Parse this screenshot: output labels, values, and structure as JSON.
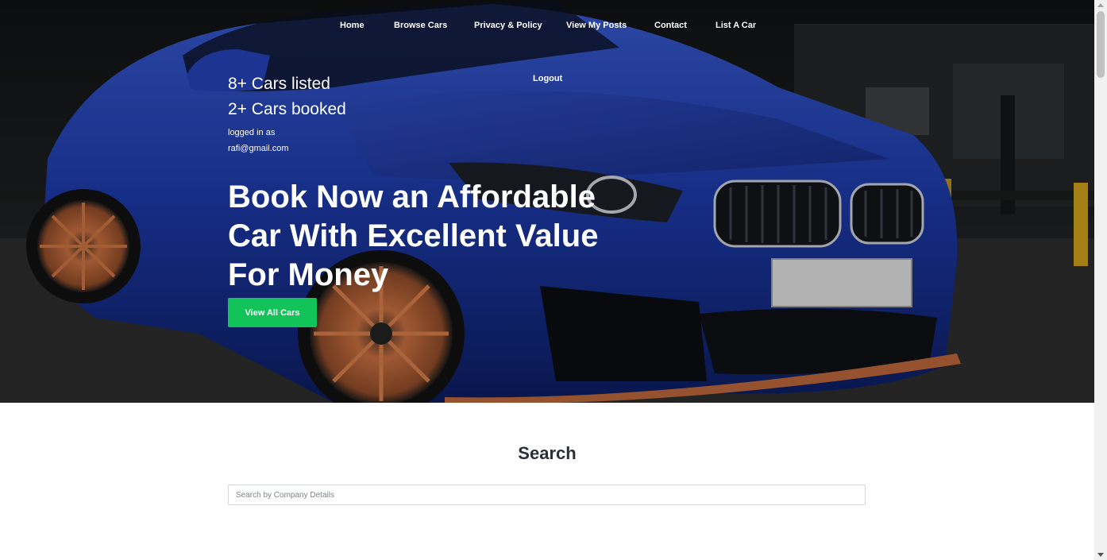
{
  "nav": {
    "items": [
      {
        "label": "Home"
      },
      {
        "label": "Browse Cars"
      },
      {
        "label": "Privacy & Policy"
      },
      {
        "label": "View My Posts"
      },
      {
        "label": "Contact"
      },
      {
        "label": "List A Car"
      },
      {
        "label": "Logout"
      }
    ]
  },
  "hero": {
    "cars_listed": "8+ Cars listed",
    "cars_booked": "2+ Cars booked",
    "logged_in_label": "logged in as",
    "user_email": "rafi@gmail.com",
    "headline": "Book Now an Affordable Car With Excellent Value For Money",
    "cta_label": "View All Cars"
  },
  "search": {
    "title": "Search",
    "placeholder": "Search by Company Details",
    "value": ""
  },
  "colors": {
    "accent_green": "#12c35a",
    "car_blue": "#1f3a9c",
    "rim_copper": "#b8653a",
    "heading_dark": "#2b2f3a"
  }
}
